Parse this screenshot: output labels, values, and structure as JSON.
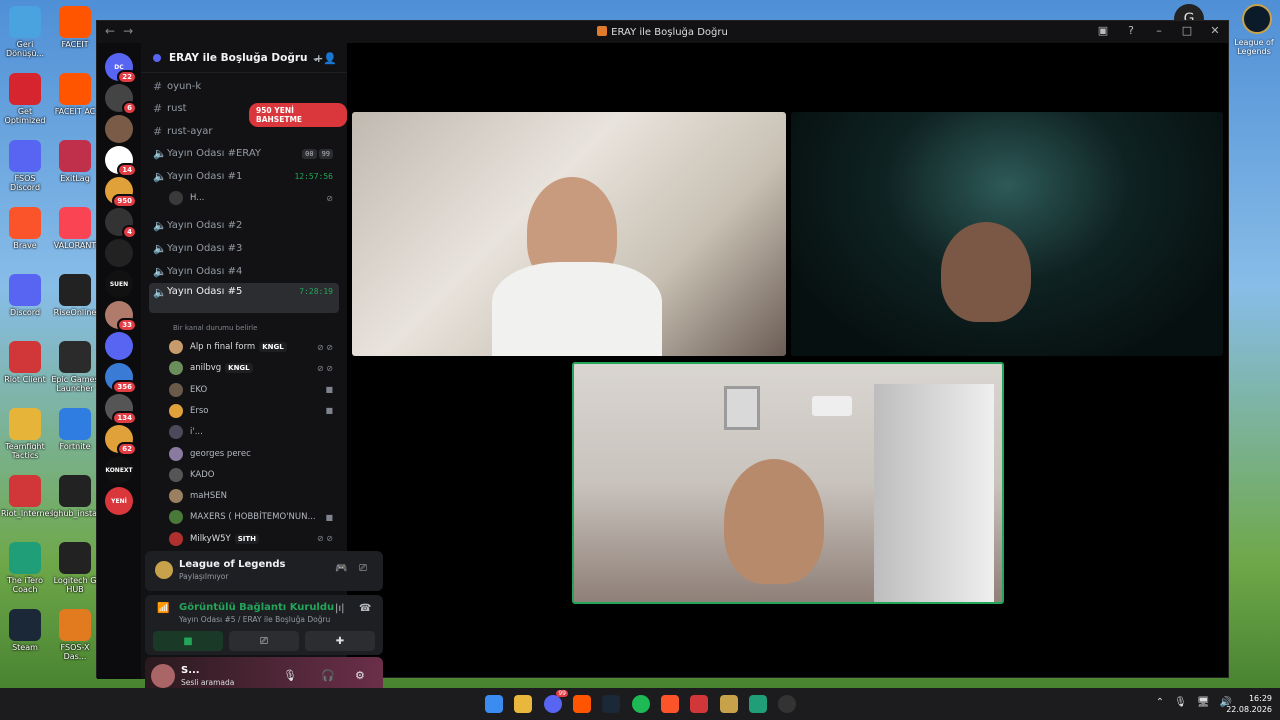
{
  "desktop": {
    "icons_left": [
      {
        "label": "Geri Dönüşü...",
        "color": "#4aa3df"
      },
      {
        "label": "Get Optimized",
        "color": "#d6252e"
      },
      {
        "label": "FSOS Discord",
        "color": "#5865f2"
      },
      {
        "label": "Brave",
        "color": "#fb542b"
      },
      {
        "label": "Discord",
        "color": "#5865f2"
      },
      {
        "label": "Riot Client",
        "color": "#d13639"
      },
      {
        "label": "Teamfight Tactics",
        "color": "#e7b43a"
      },
      {
        "label": "Riot_Internes",
        "color": "#d13639"
      },
      {
        "label": "The iTero Coach",
        "color": "#1f9e77"
      },
      {
        "label": "Steam",
        "color": "#1b2838"
      }
    ],
    "icons_right": [
      {
        "label": "FACEIT",
        "color": "#ff5500"
      },
      {
        "label": "FACEIT AC",
        "color": "#ff5500"
      },
      {
        "label": "ExitLag",
        "color": "#c0304a"
      },
      {
        "label": "VALORANT",
        "color": "#fa4454"
      },
      {
        "label": "RiseOnline",
        "color": "#222222"
      },
      {
        "label": "Epic Games Launcher",
        "color": "#2b2b2b"
      },
      {
        "label": "Fortnite",
        "color": "#2f7de1"
      },
      {
        "label": "lghub_instal...",
        "color": "#222222"
      },
      {
        "label": "Logitech G HUB",
        "color": "#222222"
      },
      {
        "label": "FSOS-X Das...",
        "color": "#e27b1f"
      }
    ],
    "top_right_icon_label": "League of Legends"
  },
  "window": {
    "title": "ERAY ile Boşluğa Doğru",
    "nav_back": "←",
    "nav_fwd": "→"
  },
  "rail": {
    "servers": [
      {
        "badge": "22",
        "color": "#5865f2",
        "text": "DC"
      },
      {
        "badge": "6",
        "color": "#444444",
        "text": ""
      },
      {
        "badge": "",
        "color": "#7a5b47",
        "text": ""
      },
      {
        "badge": "14",
        "color": "#ffffff",
        "text": ""
      },
      {
        "badge": "950",
        "color": "#e0a03a",
        "text": ""
      },
      {
        "badge": "4",
        "color": "#333333",
        "text": ""
      },
      {
        "badge": "",
        "color": "#222222",
        "text": ""
      },
      {
        "badge": "",
        "color": "#111111",
        "text": "SUEN"
      },
      {
        "badge": "33",
        "color": "#b07b6b",
        "text": ""
      },
      {
        "badge": "",
        "color": "#5865f2",
        "text": ""
      },
      {
        "badge": "356",
        "color": "#3a7bd5",
        "text": ""
      },
      {
        "badge": "134",
        "color": "#555555",
        "text": ""
      },
      {
        "badge": "62",
        "color": "#e0a03a",
        "text": ""
      },
      {
        "badge": "",
        "color": "#111111",
        "text": "KONEXT"
      },
      {
        "badge": "",
        "color": "#da373c",
        "text": "YENİ"
      }
    ]
  },
  "sidebar": {
    "server_name": "ERAY ile Boşluğa Doğru",
    "mention_pill": "950 YENİ BAHSETME",
    "channels": [
      {
        "name": "oyun-k",
        "type": "text"
      },
      {
        "name": "rust",
        "type": "text"
      },
      {
        "name": "rust-ayar",
        "type": "text"
      },
      {
        "name": "Yayın Odası #ERAY",
        "type": "voice",
        "extra1": "00",
        "extra2": "99"
      },
      {
        "name": "Yayın Odası #1",
        "type": "voice",
        "time": "12:57:56"
      },
      {
        "name": "Yayın Odası #2",
        "type": "voice"
      },
      {
        "name": "Yayın Odası #3",
        "type": "voice"
      },
      {
        "name": "Yayın Odası #4",
        "type": "voice"
      },
      {
        "name": "Yayın Odası #5",
        "type": "voice",
        "time": "7:28:19",
        "status": "Bir kanal durumu belirle"
      }
    ],
    "room1_user": "H...",
    "room5_users": [
      {
        "name": "Alp n final form",
        "tag": "KNGL",
        "color": "#c79b6b"
      },
      {
        "name": "anilbvg",
        "tag": "KNGL",
        "color": "#6b8f5b"
      },
      {
        "name": "EKO",
        "tag": "",
        "color": "#6a5a4a"
      },
      {
        "name": "Erso",
        "tag": "",
        "color": "#e0a03a"
      },
      {
        "name": "i'...",
        "tag": "",
        "color": "#4a4a5a"
      },
      {
        "name": "georges perec",
        "tag": "",
        "color": "#8a7aa0"
      },
      {
        "name": "KADO",
        "tag": "",
        "color": "#555555"
      },
      {
        "name": "maHSEN",
        "tag": "",
        "color": "#9a8060"
      },
      {
        "name": "MAXERS ( HOBBİTEMO'NUN...",
        "tag": "",
        "color": "#4a7a3a"
      },
      {
        "name": "MilkyW5Y",
        "tag": "SITH",
        "color": "#b03030"
      }
    ],
    "activity": {
      "title": "League of Legends",
      "sub": "Paylaşılmıyor"
    },
    "voice": {
      "title": "Görüntülü Bağlantı Kuruldu",
      "sub": "Yayın Odası #5 / ERAY ile Boşluğa Doğru"
    },
    "user": {
      "name": "S...",
      "status": "Sesli aramada"
    }
  },
  "taskbar": {
    "time": "16:29",
    "date": "22.08.2026",
    "discord_badge": "99"
  }
}
